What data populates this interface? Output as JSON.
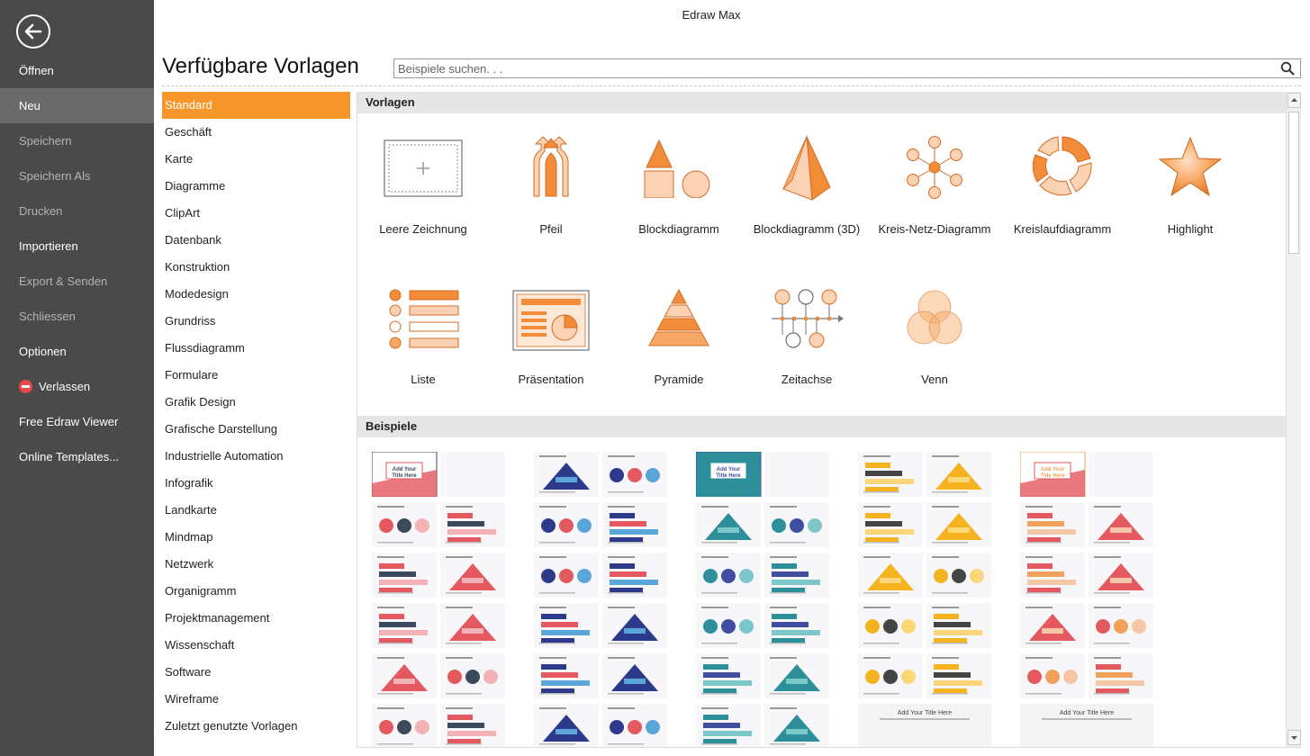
{
  "app_title": "Edraw Max",
  "page_title": "Verfügbare Vorlagen",
  "search": {
    "placeholder": "Beispiele suchen. . ."
  },
  "nav": {
    "items": [
      {
        "label": "Öffnen",
        "state": "enabled"
      },
      {
        "label": "Neu",
        "state": "active"
      },
      {
        "label": "Speichern",
        "state": "disabled"
      },
      {
        "label": "Speichern Als",
        "state": "disabled"
      },
      {
        "label": "Drucken",
        "state": "disabled"
      },
      {
        "label": "Importieren",
        "state": "enabled"
      },
      {
        "label": "Export & Senden",
        "state": "disabled"
      },
      {
        "label": "Schliessen",
        "state": "disabled"
      },
      {
        "label": "Optionen",
        "state": "enabled"
      },
      {
        "label": "Verlassen",
        "state": "enabled"
      },
      {
        "label": "Free Edraw Viewer",
        "state": "enabled"
      },
      {
        "label": "Online Templates...",
        "state": "enabled"
      }
    ]
  },
  "categories": [
    "Standard",
    "Geschäft",
    "Karte",
    "Diagramme",
    "ClipArt",
    "Datenbank",
    "Konstruktion",
    "Modedesign",
    "Grundriss",
    "Flussdiagramm",
    "Formulare",
    "Grafik Design",
    "Grafische Darstellung",
    "Industrielle Automation",
    "Infografik",
    "Landkarte",
    "Mindmap",
    "Netzwerk",
    "Organigramm",
    "Projektmanagement",
    "Wissenschaft",
    "Software",
    "Wireframe",
    "Zuletzt genutzte Vorlagen"
  ],
  "selected_category": "Standard",
  "sections": {
    "templates": "Vorlagen",
    "examples": "Beispiele"
  },
  "templates": [
    {
      "label": "Leere Zeichnung",
      "icon": "blank-drawing-icon"
    },
    {
      "label": "Pfeil",
      "icon": "arrow-icon"
    },
    {
      "label": "Blockdiagramm",
      "icon": "block-diagram-icon"
    },
    {
      "label": "Blockdiagramm (3D)",
      "icon": "block-diagram-3d-icon"
    },
    {
      "label": "Kreis-Netz-Diagramm",
      "icon": "circle-network-icon"
    },
    {
      "label": "Kreislaufdiagramm",
      "icon": "cycle-diagram-icon"
    },
    {
      "label": "Highlight",
      "icon": "highlight-star-icon"
    },
    {
      "label": "Liste",
      "icon": "list-icon"
    },
    {
      "label": "Präsentation",
      "icon": "presentation-icon"
    },
    {
      "label": "Pyramide",
      "icon": "pyramid-icon"
    },
    {
      "label": "Zeitachse",
      "icon": "timeline-icon"
    },
    {
      "label": "Venn",
      "icon": "venn-icon"
    }
  ],
  "example_labels": {
    "add_title": "Add Your Title Here"
  },
  "colors": {
    "accent": "#f7962b",
    "nav_bg": "#4a4a4a",
    "icon_orange": "#f28c38",
    "icon_peach": "#fbd2b4"
  }
}
